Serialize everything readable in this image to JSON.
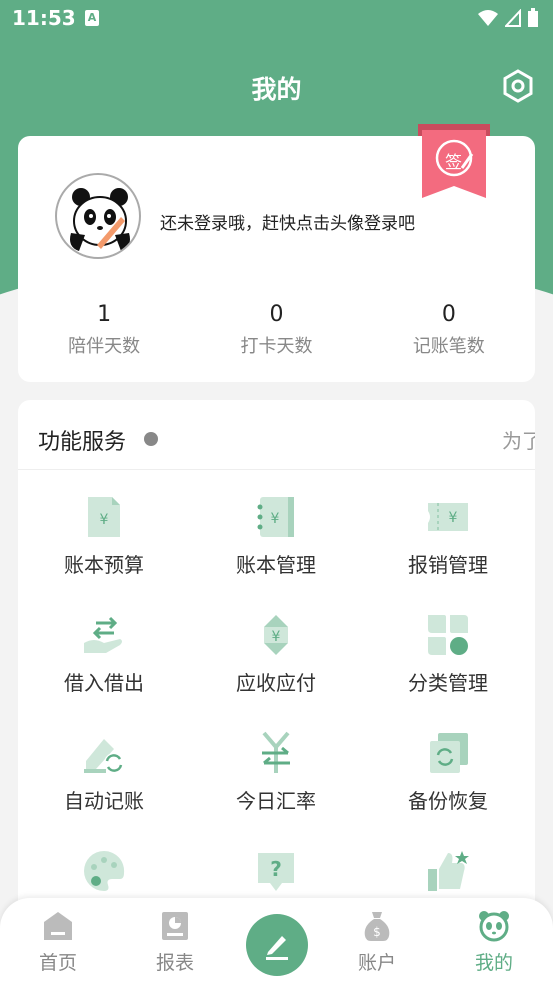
{
  "status_bar": {
    "time": "11:53",
    "notification": "A"
  },
  "header": {
    "title": "我的"
  },
  "profile": {
    "login_prompt": "还未登录哦，赶快点击头像登录吧",
    "sign_in_badge": "签",
    "stats": [
      {
        "value": "1",
        "label": "陪伴天数"
      },
      {
        "value": "0",
        "label": "打卡天数"
      },
      {
        "value": "0",
        "label": "记账笔数"
      }
    ]
  },
  "services": {
    "title": "功能服务",
    "marquee": "为了",
    "items": [
      {
        "label": "账本预算",
        "icon": "budget-icon"
      },
      {
        "label": "账本管理",
        "icon": "ledger-manage-icon"
      },
      {
        "label": "报销管理",
        "icon": "reimburse-icon"
      },
      {
        "label": "借入借出",
        "icon": "borrow-lend-icon"
      },
      {
        "label": "应收应付",
        "icon": "receivable-payable-icon"
      },
      {
        "label": "分类管理",
        "icon": "category-icon"
      },
      {
        "label": "自动记账",
        "icon": "auto-record-icon"
      },
      {
        "label": "今日汇率",
        "icon": "exchange-rate-icon"
      },
      {
        "label": "备份恢复",
        "icon": "backup-restore-icon"
      },
      {
        "label": "",
        "icon": "palette-icon"
      },
      {
        "label": "",
        "icon": "help-icon"
      },
      {
        "label": "",
        "icon": "thumbs-up-icon"
      }
    ]
  },
  "bottom_nav": {
    "items": [
      {
        "label": "首页",
        "icon": "home-icon"
      },
      {
        "label": "报表",
        "icon": "report-icon"
      },
      {
        "label": "账户",
        "icon": "account-icon"
      },
      {
        "label": "我的",
        "icon": "panda-icon",
        "active": true
      }
    ]
  },
  "colors": {
    "primary": "#5fad86",
    "icon_light": "#cfe7da",
    "icon_dark": "#5fad86",
    "ribbon": "#f36b7f"
  }
}
